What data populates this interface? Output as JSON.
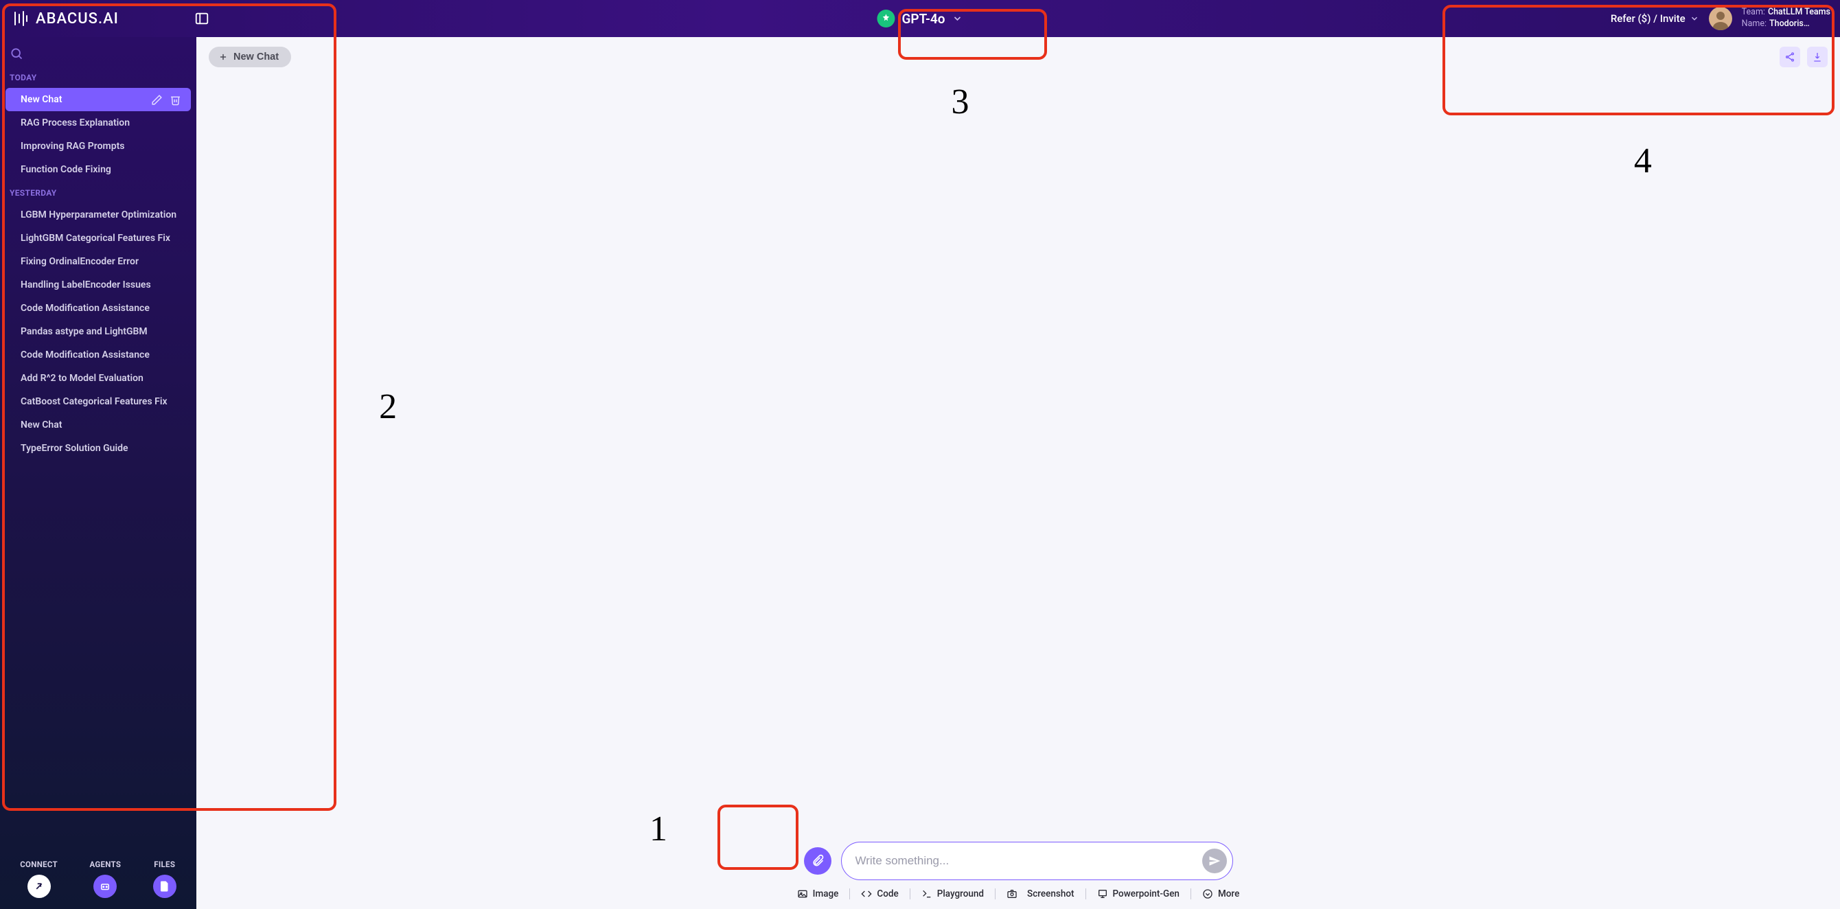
{
  "brand": "ABACUS.AI",
  "topbar": {
    "model_name": "GPT-4o",
    "refer_label": "Refer ($) / Invite",
    "team_label": "Team:",
    "team_value": "ChatLLM Teams",
    "name_label": "Name:",
    "name_value": "Thodoris…"
  },
  "sidebar": {
    "sections": [
      {
        "label": "TODAY",
        "items": [
          {
            "label": "New Chat",
            "active": true
          },
          {
            "label": "RAG Process Explanation"
          },
          {
            "label": "Improving RAG Prompts"
          },
          {
            "label": "Function Code Fixing"
          }
        ]
      },
      {
        "label": "YESTERDAY",
        "items": [
          {
            "label": "LGBM Hyperparameter Optimization"
          },
          {
            "label": "LightGBM Categorical Features Fix"
          },
          {
            "label": "Fixing OrdinalEncoder Error"
          },
          {
            "label": "Handling LabelEncoder Issues"
          },
          {
            "label": "Code Modification Assistance"
          },
          {
            "label": "Pandas astype and LightGBM"
          },
          {
            "label": "Code Modification Assistance"
          },
          {
            "label": "Add R^2 to Model Evaluation"
          },
          {
            "label": "CatBoost Categorical Features Fix"
          },
          {
            "label": "New Chat"
          },
          {
            "label": "TypeError Solution Guide"
          }
        ]
      }
    ],
    "footer": {
      "connect": "CONNECT",
      "agents": "AGENTS",
      "files": "FILES"
    }
  },
  "main": {
    "new_chat_label": "New Chat",
    "input_placeholder": "Write something...",
    "tools": {
      "image": "Image",
      "code": "Code",
      "playground": "Playground",
      "screenshot": "Screenshot",
      "powerpoint": "Powerpoint-Gen",
      "more": "More"
    }
  },
  "annotations": {
    "n1": "1",
    "n2": "2",
    "n3": "3",
    "n4": "4"
  },
  "colors": {
    "accent": "#7c5cff",
    "annot": "#e8311a",
    "bg_dark": "#2a0d66",
    "bg_light": "#f6f6fb"
  }
}
